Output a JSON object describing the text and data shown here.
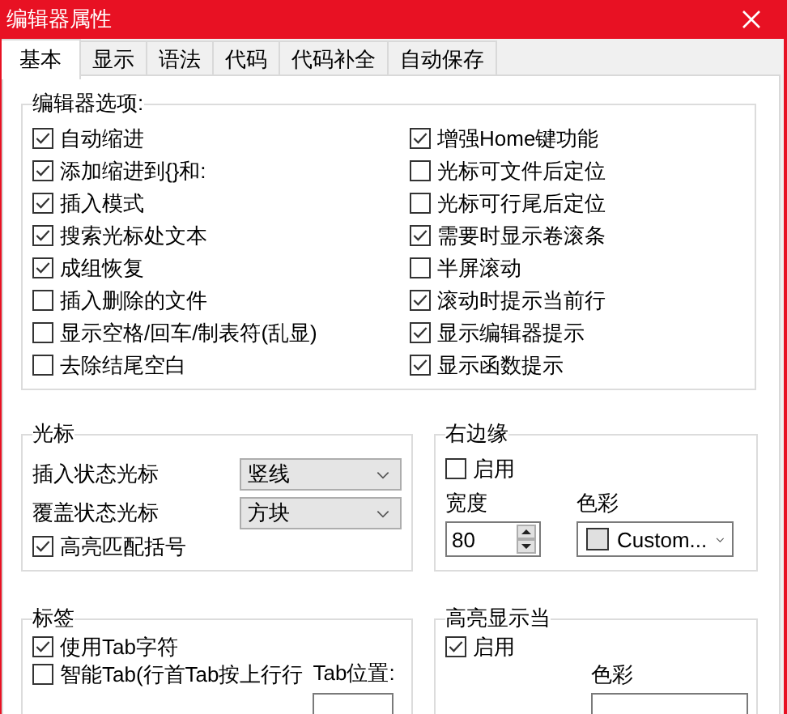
{
  "window": {
    "title": "编辑器属性"
  },
  "tabs": [
    {
      "label": "基本",
      "selected": true
    },
    {
      "label": "显示",
      "selected": false
    },
    {
      "label": "语法",
      "selected": false
    },
    {
      "label": "代码",
      "selected": false
    },
    {
      "label": "代码补全",
      "selected": false
    },
    {
      "label": "自动保存",
      "selected": false
    }
  ],
  "editor_options": {
    "title": "编辑器选项:",
    "left": [
      {
        "label": "自动缩进",
        "checked": true
      },
      {
        "label": "添加缩进到{}和:",
        "checked": true
      },
      {
        "label": "插入模式",
        "checked": true
      },
      {
        "label": "搜索光标处文本",
        "checked": true
      },
      {
        "label": "成组恢复",
        "checked": true
      },
      {
        "label": "插入删除的文件",
        "checked": false
      },
      {
        "label": "显示空格/回车/制表符(乱显)",
        "checked": false
      },
      {
        "label": "去除结尾空白",
        "checked": false
      }
    ],
    "right": [
      {
        "label": "增强Home键功能",
        "checked": true
      },
      {
        "label": "光标可文件后定位",
        "checked": false
      },
      {
        "label": "光标可行尾后定位",
        "checked": false
      },
      {
        "label": "需要时显示卷滚条",
        "checked": true
      },
      {
        "label": "半屏滚动",
        "checked": false
      },
      {
        "label": "滚动时提示当前行",
        "checked": true
      },
      {
        "label": "显示编辑器提示",
        "checked": true
      },
      {
        "label": "显示函数提示",
        "checked": true
      }
    ]
  },
  "cursor": {
    "title": "光标",
    "fields": [
      {
        "label": "插入状态光标",
        "value": "竖线"
      },
      {
        "label": "覆盖状态光标",
        "value": "方块"
      }
    ],
    "options": [
      {
        "label": "高亮匹配括号",
        "checked": true
      }
    ]
  },
  "right_margin": {
    "title": "右边缘",
    "enable": {
      "label": "启用",
      "checked": false
    },
    "width_label": "宽度",
    "width_value": "80",
    "color_label": "色彩",
    "color_value": "Custom...",
    "color": "#e0e0e0"
  },
  "tab_group": {
    "title": "标签",
    "options": [
      {
        "label": "使用Tab字符",
        "checked": true
      },
      {
        "label": "智能Tab(行首Tab按上行行",
        "checked": false
      }
    ],
    "tab_position_label": "Tab位置:"
  },
  "highlight_line": {
    "title": "高亮显示当",
    "enable": {
      "label": "启用",
      "checked": true
    },
    "color_label": "色彩"
  }
}
